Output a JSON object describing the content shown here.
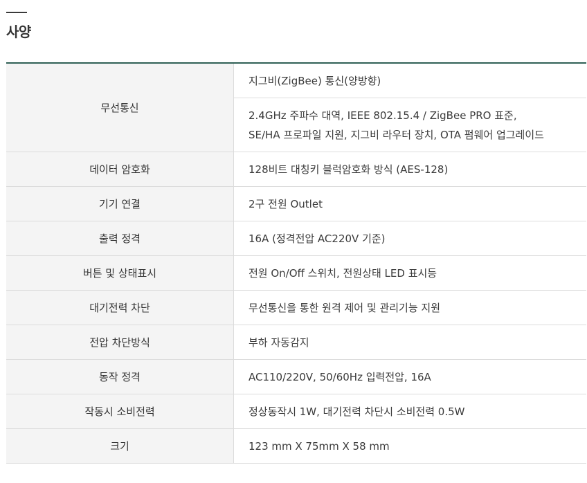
{
  "section": {
    "title": "사양"
  },
  "specs": [
    {
      "label": "무선통신",
      "values": [
        "지그비(ZigBee) 통신(양방향)",
        [
          "2.4GHz 주파수 대역, IEEE 802.15.4 / ZigBee PRO 표준,",
          "SE/HA 프로파일 지원, 지그비 라우터 장치, OTA 펌웨어 업그레이드"
        ]
      ]
    },
    {
      "label": "데이터 암호화",
      "value": "128비트 대칭키 블럭암호화 방식 (AES-128)"
    },
    {
      "label": "기기 연결",
      "value": "2구 전원 Outlet"
    },
    {
      "label": "출력 정격",
      "value": "16A (정격전압 AC220V 기준)"
    },
    {
      "label": "버튼 및 상태표시",
      "value": "전원 On/Off 스위치, 전원상태 LED 표시등"
    },
    {
      "label": "대기전력 차단",
      "value": "무선통신을 통한 원격 제어 및 관리기능 지원"
    },
    {
      "label": "전압 차단방식",
      "value": "부하 자동감지"
    },
    {
      "label": "동작 정격",
      "value": "AC110/220V, 50/60Hz 입력전압, 16A"
    },
    {
      "label": "작동시 소비전력",
      "value": "정상동작시 1W, 대기전력 차단시 소비전력 0.5W"
    },
    {
      "label": "크기",
      "value": "123 mm X 75mm X 58 mm"
    }
  ]
}
